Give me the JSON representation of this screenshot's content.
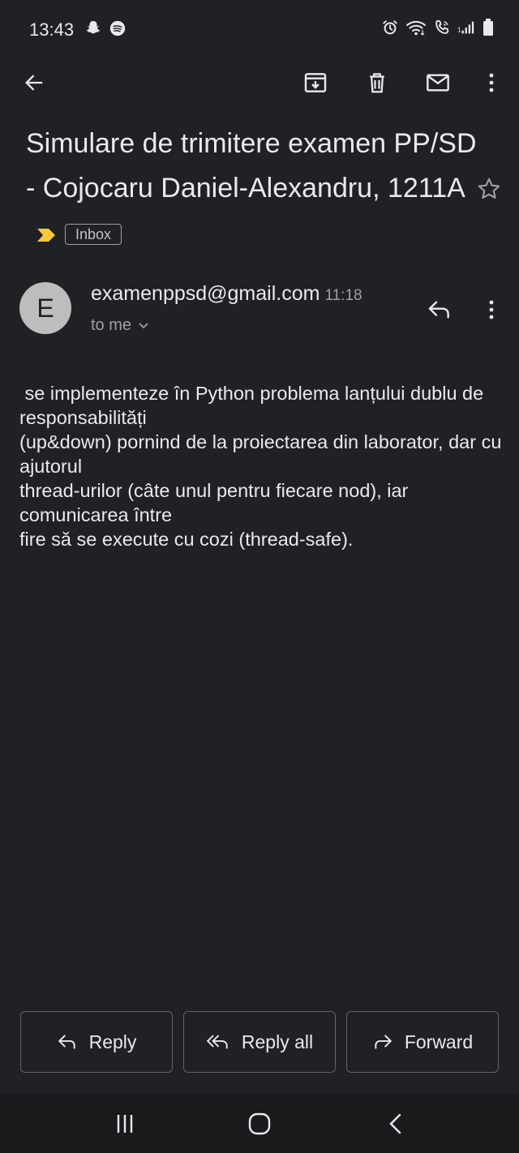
{
  "status_bar": {
    "time": "13:43",
    "left_icons": [
      "snapchat-icon",
      "spotify-icon"
    ],
    "right_icons": [
      "alarm-icon",
      "wifi-icon",
      "volte-call-icon",
      "signal-icon",
      "battery-icon"
    ]
  },
  "toolbar": {
    "back": "back-arrow-icon",
    "actions": [
      "archive-icon",
      "delete-icon",
      "mark-unread-icon",
      "more-vert-icon"
    ]
  },
  "email": {
    "subject": "Simulare de trimitere examen PP/SD - Cojocaru Daniel-Alexandru, 1211A",
    "label": "Inbox",
    "importance_color": "#f9c838",
    "avatar_initial": "E",
    "sender": "examenppsd@gmail.com",
    "time": "11:18",
    "recipient": "to me",
    "body_lines": [
      " se implementeze în Python problema lanțului dublu de responsabilități",
      "(up&down) pornind de la proiectarea din laborator, dar cu ajutorul",
      "thread-urilor (câte unul pentru fiecare nod), iar comunicarea între",
      "fire să se execute cu cozi (thread-safe)."
    ]
  },
  "actions": {
    "reply": "Reply",
    "reply_all": "Reply all",
    "forward": "Forward"
  },
  "colors": {
    "background": "#202124",
    "text": "#e8eaed",
    "secondary": "#9aa0a6",
    "border": "#5f6368"
  }
}
